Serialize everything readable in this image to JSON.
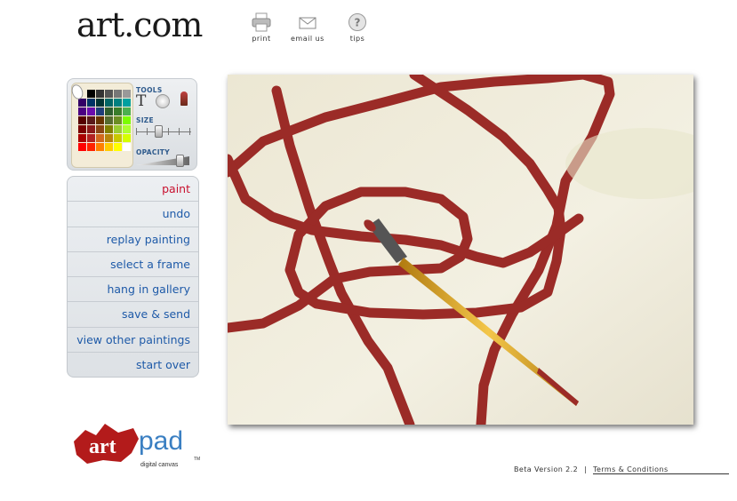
{
  "site_title": "art.com",
  "top_nav": {
    "print": "print",
    "email": "email us",
    "tips": "tips"
  },
  "tools": {
    "tools_label": "TOOLS",
    "text_tool": "T",
    "size_label": "SIZE",
    "opacity_label": "OPACITY",
    "palette_colors": [
      "#000000",
      "#333333",
      "#555555",
      "#777777",
      "#999999",
      "#330066",
      "#003366",
      "#003333",
      "#006666",
      "#008080",
      "#00a0a0",
      "#4b0082",
      "#6a0dad",
      "#1f3d7a",
      "#2e5d2e",
      "#3a7d2a",
      "#4caf50",
      "#550000",
      "#5a1a1a",
      "#663300",
      "#556b2f",
      "#6b8e23",
      "#7cfc00",
      "#7a0000",
      "#8b1a1a",
      "#8b4513",
      "#808000",
      "#9acd32",
      "#adff2f",
      "#aa0000",
      "#b22222",
      "#d2691e",
      "#b8860b",
      "#c8c800",
      "#d4ff00",
      "#ff0000",
      "#ff2200",
      "#ff8000",
      "#ffcc00",
      "#ffff00",
      "#ffffff"
    ]
  },
  "menu": [
    "paint",
    "undo",
    "replay painting",
    "select a frame",
    "hang in gallery",
    "save & send",
    "view other paintings",
    "start over"
  ],
  "brand": {
    "art": "art",
    "pad": "pad",
    "tagline": "digital canvas",
    "tm": "TM"
  },
  "footer": {
    "version": "Beta Version 2.2",
    "separator": "|",
    "terms": "Terms & Conditions"
  },
  "colors": {
    "stroke": "#9b2b27",
    "canvas": "#efebda",
    "menu_text": "#1e5aa8",
    "menu_active": "#c8102e"
  }
}
